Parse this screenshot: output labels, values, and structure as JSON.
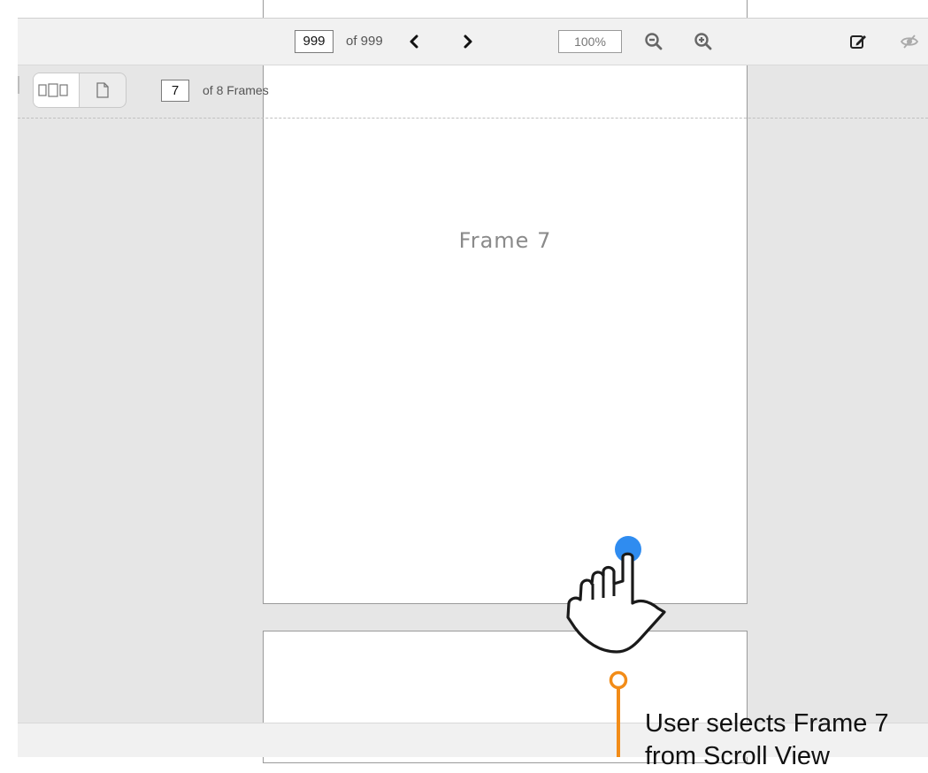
{
  "toolbar": {
    "page_current": "999",
    "page_of": "of 999",
    "zoom_value": "100%",
    "icons": [
      "chevron-left-icon",
      "chevron-right-icon",
      "zoom-out-icon",
      "zoom-in-icon",
      "edit-icon",
      "hide-icon"
    ]
  },
  "frame_nav": {
    "current": "7",
    "of_label": "of 8 Frames",
    "view_modes": [
      "multi-page-icon",
      "single-page-icon"
    ]
  },
  "frame": {
    "title": "Frame 7"
  },
  "annotation": {
    "line1": "User selects Frame 7",
    "line2": "from Scroll View",
    "accent_color": "#f28c18",
    "tap_color": "#2f8cf0"
  }
}
